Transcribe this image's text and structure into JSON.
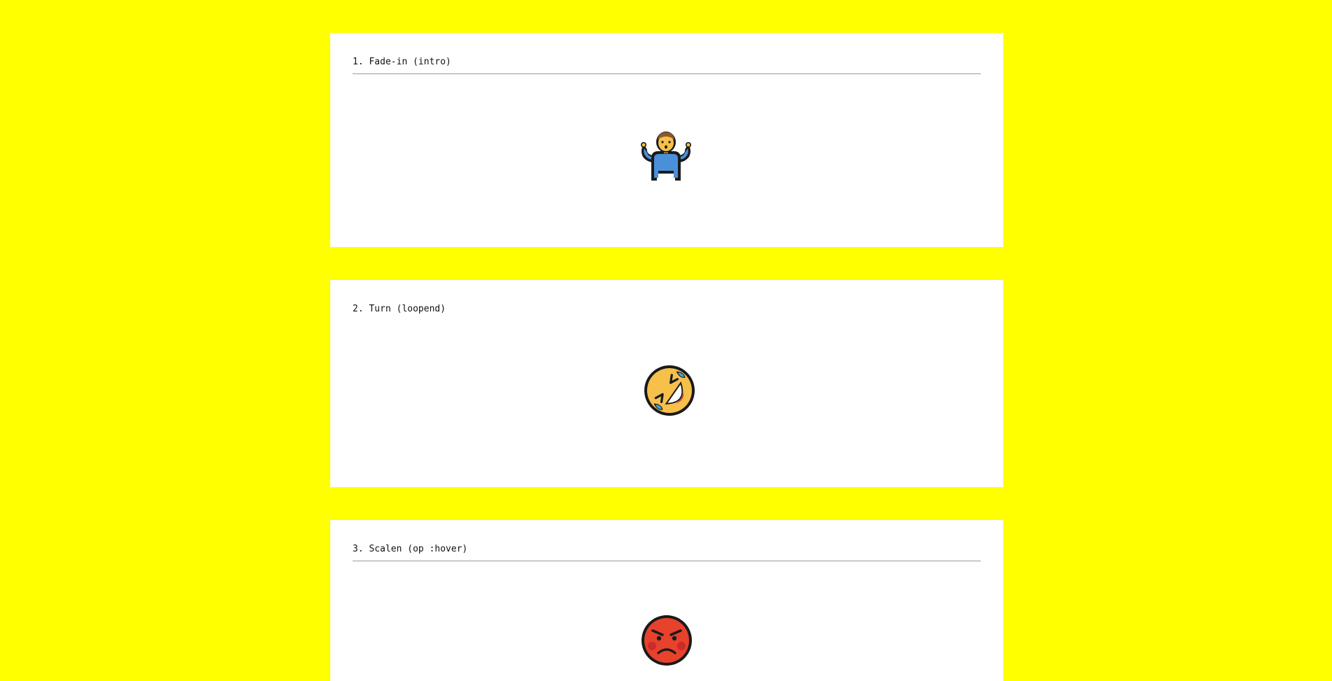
{
  "sections": [
    {
      "title": "1. Fade-in (intro)",
      "emoji": "person-shrugging-icon"
    },
    {
      "title": "2. Turn (loopend)",
      "emoji": "rolling-on-floor-laughing-icon"
    },
    {
      "title": "3. Scalen (op :hover)",
      "emoji": "pouting-face-icon"
    }
  ],
  "colors": {
    "page_background": "#ffff00",
    "card_background": "#ffffff",
    "rule": "#999999"
  }
}
